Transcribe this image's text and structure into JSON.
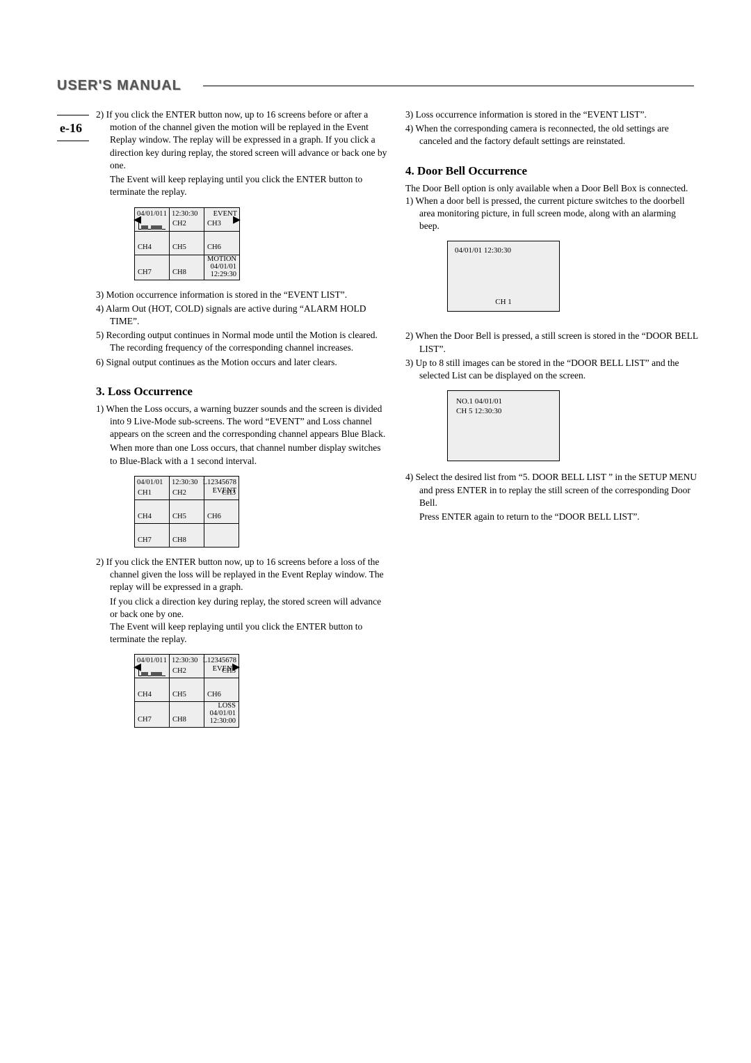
{
  "header": {
    "title": "USER'S MANUAL"
  },
  "page_label": "e-16",
  "left": {
    "motion": {
      "p2a": "2) If you click the ENTER button now, up to 16 screens before or after a motion of the channel given the motion will be replayed in the Event Replay window. The replay will be expressed in a graph. If you click a direction key during replay, the stored screen will advance or back one by one.",
      "p2b": "The Event will keep replaying until you click the ENTER button to terminate the replay.",
      "table": {
        "r1c1_date": "04/01/01",
        "r1c1_one": "1",
        "r1c2_time": "12:30:30",
        "r1c2_ch": "CH2",
        "r1c3_event": "EVENT",
        "r1c3_ch": "CH3",
        "r2c1": "CH4",
        "r2c2": "CH5",
        "r2c3": "CH6",
        "r3c1": "CH7",
        "r3c2": "CH8",
        "r3c3_a": "MOTION",
        "r3c3_b": "04/01/01",
        "r3c3_c": "12:29:30"
      },
      "p3": "3) Motion occurrence information is stored in the “EVENT LIST”.",
      "p4": "4) Alarm Out (HOT, COLD) signals are active during “ALARM HOLD TIME”.",
      "p5": "5) Recording output continues in Normal mode until the Motion is cleared. The recording frequency of the corresponding channel increases.",
      "p6": "6) Signal output continues as the Motion occurs and later clears."
    },
    "loss": {
      "heading": "3. Loss Occurrence",
      "p1a": "1) When the Loss occurs, a warning buzzer sounds and the screen is divided into 9 Live-Mode sub-screens. The word “EVENT” and Loss channel appears on the screen and the corresponding channel appears Blue Black.",
      "p1b": "When more than one Loss occurs, that channel number display switches to Blue-Black with a 1 second interval.",
      "table1": {
        "r1c1_date": "04/01/01",
        "r1c1_ch": "CH1",
        "r1c2_time": "12:30:30",
        "r1c2_ch": "CH2",
        "r1c3_code": "L12345678",
        "r1c3_event": "EVENT",
        "r1c3_ch": "CH3",
        "r2c1": "CH4",
        "r2c2": "CH5",
        "r2c3": "CH6",
        "r3c1": "CH7",
        "r3c2": "CH8"
      },
      "p2a": "2) If you click the ENTER button now, up to 16 screens before a loss of the channel given the loss will be replayed in the Event Replay window. The replay will be expressed in a graph.",
      "p2b": "If you click a direction key during replay, the stored screen will advance or back one by one.",
      "p2c": "The Event will keep replaying until you click the ENTER button to terminate the replay.",
      "table2": {
        "r1c1_date": "04/01/01",
        "r1c1_one": "1",
        "r1c2_time": "12:30:30",
        "r1c2_ch": "CH2",
        "r1c3_code": "L12345678",
        "r1c3_event": "EVENT",
        "r1c3_ch": "CH3",
        "r2c1": "CH4",
        "r2c2": "CH5",
        "r2c3": "CH6",
        "r3c1": "CH7",
        "r3c2": "CH8",
        "r3c3_a": "LOSS",
        "r3c3_b": "04/01/01",
        "r3c3_c": "12:30:00"
      }
    }
  },
  "right": {
    "p3": "3) Loss occurrence information is stored in the “EVENT LIST”.",
    "p4": "4) When the corresponding camera is reconnected, the  old settings are canceled and the factory default settings  are reinstated.",
    "doorbell": {
      "heading": "4. Door Bell Occurrence",
      "intro": "The Door Bell option is only available when a Door Bell Box is connected.",
      "p1": "1) When a door bell is pressed, the current picture switches to the doorbell area monitoring picture, in full screen mode, along with an alarming beep.",
      "panel1_dt": "04/01/01   12:30:30",
      "panel1_ch": "CH 1",
      "p2": "2) When the Door Bell is pressed, a still screen is stored in the “DOOR BELL LIST”.",
      "p3l": "3) Up to 8 still images can be stored in the “DOOR BELL LIST” and the selected List can be displayed  on the screen.",
      "panel2_l1": "NO.1    04/01/01",
      "panel2_l2": "CH 5    12:30:30",
      "p4a": "4) Select the desired list from “5. DOOR BELL LIST ” in the SETUP MENU and press ENTER in to replay the still screen of the corresponding Door Bell.",
      "p4b": "Press ENTER again to return to the “DOOR BELL LIST”."
    }
  }
}
